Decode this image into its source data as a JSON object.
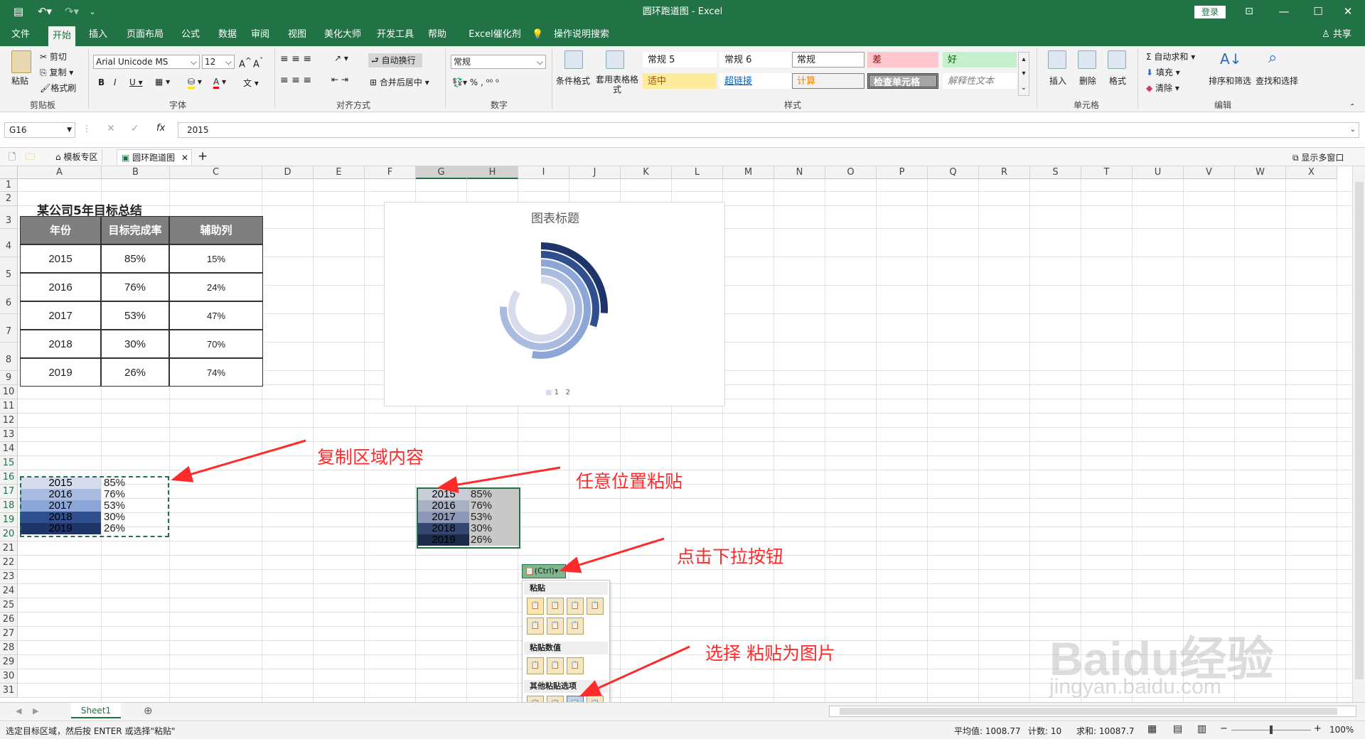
{
  "window": {
    "title": "圆环跑道图  -  Excel",
    "login": "登录"
  },
  "menu": [
    "文件",
    "开始",
    "插入",
    "页面布局",
    "公式",
    "数据",
    "审阅",
    "视图",
    "美化大师",
    "开发工具",
    "帮助",
    "Excel催化剂"
  ],
  "menu_active": 1,
  "tellme": "操作说明搜索",
  "share": "共享",
  "ribbon": {
    "clipboard": {
      "paste": "粘贴",
      "cut": "剪切",
      "copy": "复制",
      "painter": "格式刷",
      "label": "剪贴板"
    },
    "font": {
      "name": "Arial Unicode MS",
      "size": "12",
      "label": "字体"
    },
    "align": {
      "wrap": "自动换行",
      "merge": "合并后居中",
      "label": "对齐方式"
    },
    "number": {
      "format": "常规",
      "label": "数字"
    },
    "styles": {
      "cond": "条件格式",
      "table": "套用表格格式",
      "label": "样式",
      "cells": [
        "常规 5",
        "常规 6",
        "常规",
        "差",
        "好",
        "适中",
        "超链接",
        "计算",
        "检查单元格",
        "解释性文本"
      ]
    },
    "cells": {
      "insert": "插入",
      "delete": "删除",
      "format": "格式",
      "label": "单元格"
    },
    "edit": {
      "autosum": "自动求和",
      "fill": "填充",
      "clear": "清除",
      "sort": "排序和筛选",
      "find": "查找和选择",
      "label": "编辑"
    }
  },
  "formula": {
    "namebox": "G16",
    "fx": "fx",
    "value": "2015"
  },
  "tabs": {
    "t1": "模板专区",
    "t2": "圆环跑道图",
    "multi": "显示多窗口"
  },
  "columns": [
    "A",
    "B",
    "C",
    "D",
    "E",
    "F",
    "G",
    "H",
    "I",
    "J",
    "K",
    "L",
    "M",
    "N",
    "O",
    "P",
    "Q",
    "R",
    "S",
    "T",
    "U",
    "V",
    "W",
    "X"
  ],
  "rows": [
    "1",
    "2",
    "3",
    "4",
    "5",
    "6",
    "7",
    "8",
    "9",
    "10",
    "11",
    "12",
    "13",
    "14",
    "15",
    "16",
    "17",
    "18",
    "19",
    "20",
    "21",
    "22",
    "23",
    "24",
    "25",
    "26",
    "27",
    "28",
    "29",
    "30",
    "31"
  ],
  "table": {
    "title": "某公司5年目标总结",
    "headers": [
      "年份",
      "目标完成率",
      "辅助列"
    ],
    "rows": [
      [
        "2015",
        "85%",
        "15%"
      ],
      [
        "2016",
        "76%",
        "24%"
      ],
      [
        "2017",
        "53%",
        "47%"
      ],
      [
        "2018",
        "30%",
        "70%"
      ],
      [
        "2019",
        "26%",
        "74%"
      ]
    ]
  },
  "copy_block": [
    [
      "2015",
      "85%"
    ],
    [
      "2016",
      "76%"
    ],
    [
      "2017",
      "53%"
    ],
    [
      "2018",
      "30%"
    ],
    [
      "2019",
      "26%"
    ]
  ],
  "paste_block": [
    [
      "2015",
      "85%"
    ],
    [
      "2016",
      "76%"
    ],
    [
      "2017",
      "53%"
    ],
    [
      "2018",
      "30%"
    ],
    [
      "2019",
      "26%"
    ]
  ],
  "chart": {
    "title": "图表标题",
    "legend": [
      "1",
      "2"
    ]
  },
  "chart_data": {
    "type": "pie",
    "title": "图表标题",
    "categories": [
      "2015",
      "2016",
      "2017",
      "2018",
      "2019"
    ],
    "values": [
      0.85,
      0.76,
      0.53,
      0.3,
      0.26
    ],
    "colors": [
      "#d6dcec",
      "#aabbe0",
      "#8ca6d8",
      "#2f4f8f",
      "#1f3468"
    ]
  },
  "annotations": {
    "a1": "复制区域内容",
    "a2": "任意位置粘贴",
    "a3": "点击下拉按钮",
    "a4": "选择 粘贴为图片"
  },
  "paste_menu": {
    "ctrl": "(Ctrl)",
    "h1": "粘贴",
    "h2": "粘贴数值",
    "h3": "其他粘贴选项"
  },
  "sheet": {
    "name": "Sheet1"
  },
  "status": {
    "msg": "选定目标区域，然后按 ENTER 或选择\"粘贴\"",
    "avg": "平均值: 1008.77",
    "count": "计数: 10",
    "sum": "求和: 10087.7",
    "zoom": "100%"
  },
  "watermark": {
    "brand": "Baidu经验",
    "url": "jingyan.baidu.com"
  }
}
